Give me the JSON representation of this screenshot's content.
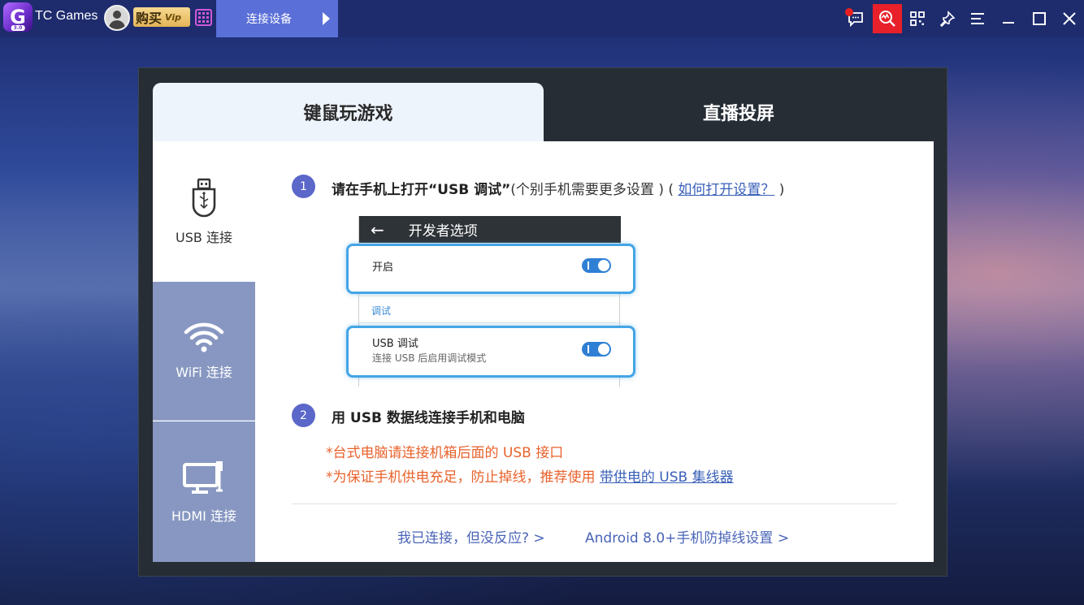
{
  "titlebar": {
    "app_title": "TC Games",
    "logo_version": "3.0",
    "vip_label": "购买",
    "vip_badge": "Vip",
    "connect_tab_label": "连接设备",
    "icons": [
      "message-icon",
      "monitor-search-icon",
      "apps-grid-icon",
      "pin-icon",
      "menu-icon",
      "minimize-icon",
      "maximize-icon",
      "close-icon"
    ]
  },
  "dialog": {
    "tabs": [
      {
        "label": "键鼠玩游戏",
        "active": true
      },
      {
        "label": "直播投屏",
        "active": false
      }
    ],
    "sidenav": [
      {
        "label": "USB 连接",
        "icon": "usb-icon",
        "active": true
      },
      {
        "label": "WiFi 连接",
        "icon": "wifi-icon",
        "active": false
      },
      {
        "label": "HDMI 连接",
        "icon": "hdmi-monitor-icon",
        "active": false
      }
    ],
    "step1": {
      "num": "1",
      "title": "请在手机上打开“USB 调试”",
      "note_open": "(个别手机需要更多设置 ) ( ",
      "link": "如何打开设置？",
      "note_close": " )"
    },
    "phone": {
      "header": "开发者选项",
      "row_open": "开启",
      "section": "调试",
      "usb_title": "USB 调试",
      "usb_sub": "连接 USB 后启用调试模式"
    },
    "step2": {
      "num": "2",
      "title": "用 USB 数据线连接手机和电脑",
      "warn1": "*台式电脑请连接机箱后面的 USB 接口",
      "warn2_text": "*为保证手机供电充足，防止掉线，推荐使用 ",
      "warn2_link": "带供电的 USB 集线器"
    },
    "bottom_links": [
      "我已连接，但没反应? >",
      "Android 8.0+手机防掉线设置 >"
    ]
  },
  "colors": {
    "accent": "#5b67c9",
    "active_tool": "#e8202a",
    "warn": "#e8622c",
    "link": "#3960b8",
    "nav_inactive": "#8797c1"
  }
}
